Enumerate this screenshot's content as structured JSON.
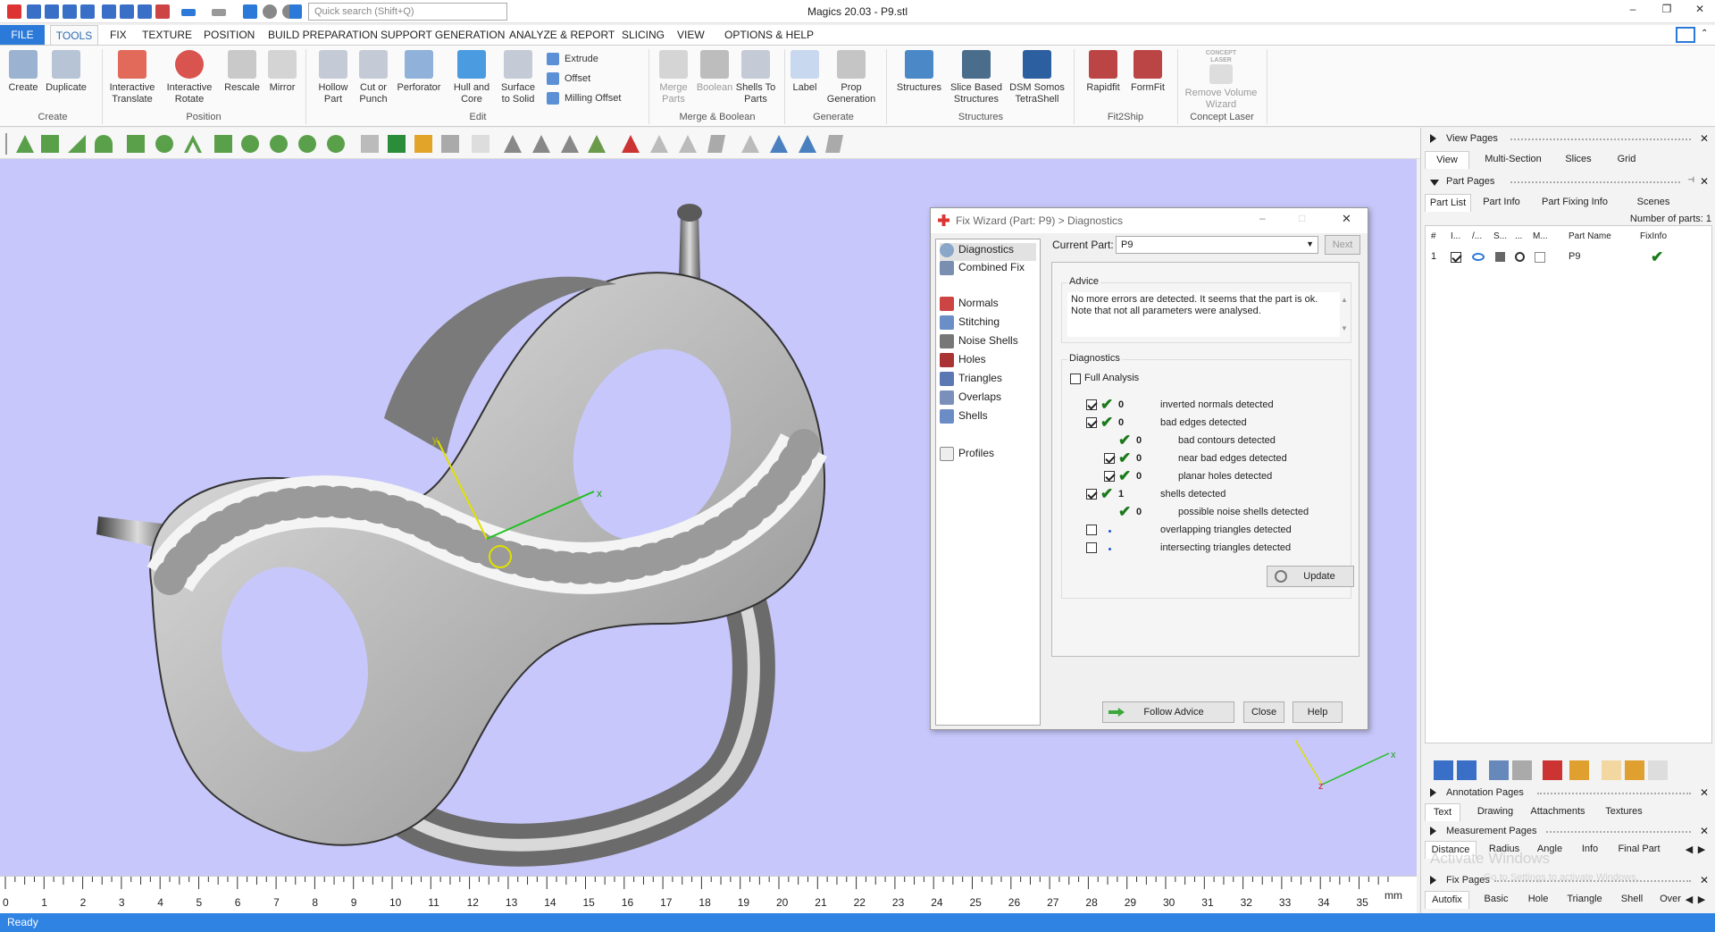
{
  "window": {
    "title": "Magics 20.03 - P9.stl",
    "search_placeholder": "Quick search (Shift+Q)"
  },
  "menu": [
    "FILE",
    "TOOLS",
    "FIX",
    "TEXTURE",
    "POSITION",
    "BUILD PREPARATION",
    "SUPPORT GENERATION",
    "ANALYZE & REPORT",
    "SLICING",
    "VIEW",
    "OPTIONS & HELP"
  ],
  "ribbon": {
    "create": "Create",
    "duplicate": "Duplicate",
    "group_create": "Create",
    "interactive_translate": "Interactive Translate",
    "interactive_rotate": "Interactive Rotate",
    "rescale": "Rescale",
    "mirror": "Mirror",
    "group_position": "Position",
    "hollow_part": "Hollow Part",
    "cut_or_punch": "Cut or Punch",
    "perforator": "Perforator",
    "hull_and_core": "Hull and Core",
    "surface_to_solid": "Surface to Solid",
    "extrude": "Extrude",
    "offset": "Offset",
    "milling_offset": "Milling Offset",
    "group_edit": "Edit",
    "merge_parts": "Merge Parts",
    "boolean": "Boolean",
    "shells_to_parts": "Shells To Parts",
    "group_merge": "Merge & Boolean",
    "label": "Label",
    "prop_generation": "Prop Generation",
    "group_generate": "Generate",
    "structures": "Structures",
    "slice_based_structures": "Slice Based Structures",
    "dsm_somos": "DSM Somos TetraShell",
    "group_structures": "Structures",
    "rapidfit": "Rapidfit",
    "formfit": "FormFit",
    "group_fit2ship": "Fit2Ship",
    "concept_laser_logo": "CONCEPT LASER",
    "remove_volume": "Remove Volume Wizard",
    "group_concept": "Concept Laser"
  },
  "viewport": {
    "axis_x": "x",
    "axis_y": "y",
    "axis_z": "z"
  },
  "ruler": {
    "numbers": [
      "0",
      "1",
      "2",
      "3",
      "4",
      "5",
      "6",
      "7",
      "8",
      "9",
      "10",
      "11",
      "12",
      "13",
      "14",
      "15",
      "16",
      "17",
      "18",
      "19",
      "20",
      "21",
      "22",
      "23",
      "24",
      "25",
      "26",
      "27",
      "28",
      "29",
      "30",
      "31",
      "32",
      "33",
      "34",
      "35"
    ],
    "unit": "mm"
  },
  "status": "Ready",
  "dialog": {
    "title": "Fix Wizard (Part: P9) > Diagnostics",
    "nav": [
      "Diagnostics",
      "Combined Fix",
      "Normals",
      "Stitching",
      "Noise Shells",
      "Holes",
      "Triangles",
      "Overlaps",
      "Shells",
      "Profiles"
    ],
    "current_part_label": "Current Part:",
    "current_part": "P9",
    "next": "Next",
    "advice_label": "Advice",
    "advice_text": "No more errors are detected. It seems that the part is ok. Note that not all parameters were analysed.",
    "diagnostics_label": "Diagnostics",
    "full_analysis": "Full Analysis",
    "rows": [
      {
        "count": "0",
        "label": "inverted normals detected"
      },
      {
        "count": "0",
        "label": "bad edges detected"
      },
      {
        "count": "0",
        "label": "bad contours detected"
      },
      {
        "count": "0",
        "label": "near bad edges detected"
      },
      {
        "count": "0",
        "label": "planar holes detected"
      },
      {
        "count": "1",
        "label": "shells detected"
      },
      {
        "count": "0",
        "label": "possible noise shells detected"
      },
      {
        "count": "",
        "label": "overlapping triangles detected"
      },
      {
        "count": "",
        "label": "intersecting triangles detected"
      }
    ],
    "update": "Update",
    "follow_advice": "Follow Advice",
    "close": "Close",
    "help": "Help"
  },
  "panel": {
    "view_pages": "View Pages",
    "view_tabs": [
      "View",
      "Multi-Section",
      "Slices",
      "Grid"
    ],
    "part_pages": "Part Pages",
    "part_tabs": [
      "Part List",
      "Part Info",
      "Part Fixing Info",
      "Scenes"
    ],
    "num_parts": "Number of parts: 1",
    "columns": [
      "#",
      "I...",
      "/...",
      "S...",
      "...",
      "M...",
      "Part Name",
      "FixInfo"
    ],
    "row_index": "1",
    "row_name": "P9",
    "annotation_pages": "Annotation Pages",
    "annotation_tabs": [
      "Text",
      "Drawing",
      "Attachments",
      "Textures"
    ],
    "measurement_pages": "Measurement Pages",
    "measurement_tabs": [
      "Distance",
      "Radius",
      "Angle",
      "Info",
      "Final Part"
    ],
    "fix_pages": "Fix Pages",
    "fix_tabs": [
      "Autofix",
      "Basic",
      "Hole",
      "Triangle",
      "Shell",
      "Over"
    ],
    "watermark1": "Activate Windows",
    "watermark2": "Go to Settings to activate Windows."
  },
  "colors": {
    "accent": "#2b79d8",
    "status_bar": "#2f84e3",
    "viewport_bg": "#c7c7fb",
    "check_green": "#1a7a1a"
  }
}
